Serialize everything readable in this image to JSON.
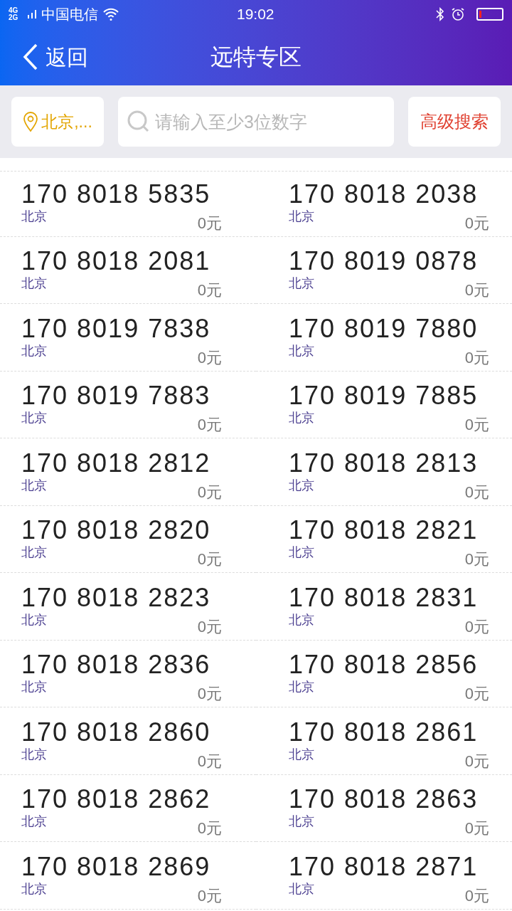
{
  "status_bar": {
    "network": "4G 2G",
    "carrier": "中国电信",
    "time": "19:02"
  },
  "header": {
    "back_label": "返回",
    "title": "远特专区"
  },
  "filter": {
    "location": "北京,...",
    "search_placeholder": "请输入至少3位数字",
    "advanced_button": "高级搜索"
  },
  "numbers": [
    {
      "number": "170 8018 5835",
      "region": "北京",
      "price": "0元"
    },
    {
      "number": "170 8018 2038",
      "region": "北京",
      "price": "0元"
    },
    {
      "number": "170 8018 2081",
      "region": "北京",
      "price": "0元"
    },
    {
      "number": "170 8019 0878",
      "region": "北京",
      "price": "0元"
    },
    {
      "number": "170 8019 7838",
      "region": "北京",
      "price": "0元"
    },
    {
      "number": "170 8019 7880",
      "region": "北京",
      "price": "0元"
    },
    {
      "number": "170 8019 7883",
      "region": "北京",
      "price": "0元"
    },
    {
      "number": "170 8019 7885",
      "region": "北京",
      "price": "0元"
    },
    {
      "number": "170 8018 2812",
      "region": "北京",
      "price": "0元"
    },
    {
      "number": "170 8018 2813",
      "region": "北京",
      "price": "0元"
    },
    {
      "number": "170 8018 2820",
      "region": "北京",
      "price": "0元"
    },
    {
      "number": "170 8018 2821",
      "region": "北京",
      "price": "0元"
    },
    {
      "number": "170 8018 2823",
      "region": "北京",
      "price": "0元"
    },
    {
      "number": "170 8018 2831",
      "region": "北京",
      "price": "0元"
    },
    {
      "number": "170 8018 2836",
      "region": "北京",
      "price": "0元"
    },
    {
      "number": "170 8018 2856",
      "region": "北京",
      "price": "0元"
    },
    {
      "number": "170 8018 2860",
      "region": "北京",
      "price": "0元"
    },
    {
      "number": "170 8018 2861",
      "region": "北京",
      "price": "0元"
    },
    {
      "number": "170 8018 2862",
      "region": "北京",
      "price": "0元"
    },
    {
      "number": "170 8018 2863",
      "region": "北京",
      "price": "0元"
    },
    {
      "number": "170 8018 2869",
      "region": "北京",
      "price": "0元"
    },
    {
      "number": "170 8018 2871",
      "region": "北京",
      "price": "0元"
    }
  ]
}
